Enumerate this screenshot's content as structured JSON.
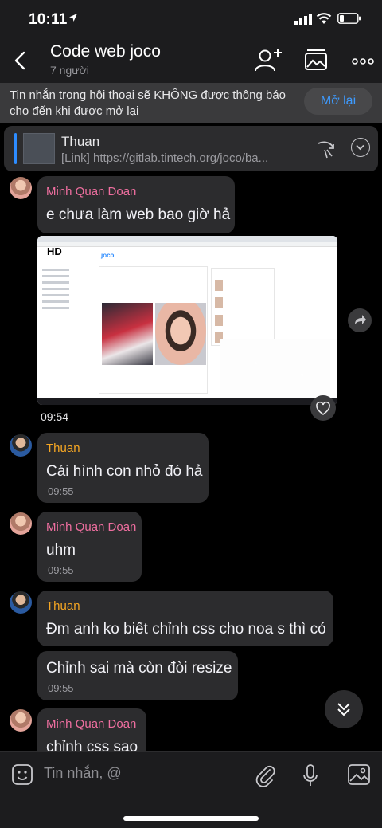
{
  "status_bar": {
    "time": "10:11"
  },
  "header": {
    "title": "Code web joco",
    "members": "7 người"
  },
  "notice": {
    "text": "Tin nhắn trong hội thoại sẽ KHÔNG được thông báo cho đến khi được mở lại",
    "reopen_label": "Mở lại"
  },
  "pinned": {
    "sender": "Thuan",
    "preview": "[Link] https://gitlab.tintech.org/joco/ba..."
  },
  "image_overlay": {
    "quality_label": "HD"
  },
  "messages": [
    {
      "sender": "Minh Quan Doan",
      "text": "e chưa làm web bao giờ hả",
      "time": ""
    },
    {
      "sender": "",
      "text": "",
      "time": "09:54"
    },
    {
      "sender": "Thuan",
      "text": "Cái hình con nhỏ đó hả",
      "time": "09:55"
    },
    {
      "sender": "Minh Quan Doan",
      "text": "uhm",
      "time": "09:55"
    },
    {
      "sender": "Thuan",
      "text": "Đm anh ko biết chỉnh css cho noa s thì có",
      "time": ""
    },
    {
      "sender": "",
      "text": "Chỉnh sai mà còn đòi resize",
      "time": "09:55"
    },
    {
      "sender": "Minh Quan Doan",
      "text": "chỉnh css sao",
      "time": ""
    }
  ],
  "input": {
    "placeholder": "Tin nhắn, @"
  },
  "colors": {
    "accent": "#3e9bff",
    "sender_pink": "#f06fa0",
    "sender_orange": "#f5a623",
    "bubble": "#2c2c2e"
  }
}
